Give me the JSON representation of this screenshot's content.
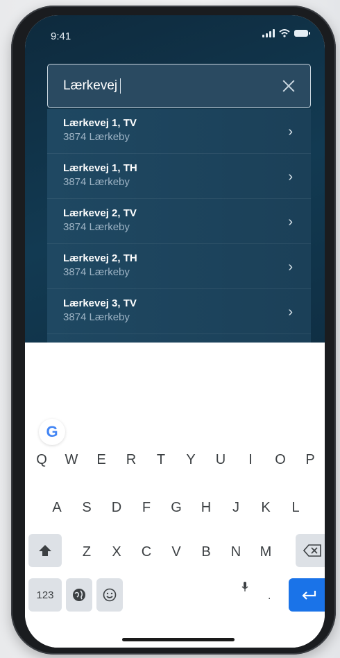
{
  "status": {
    "time": "9:41"
  },
  "search": {
    "value": "Lærkevej"
  },
  "results": [
    {
      "title": "Lærkevej 1, TV",
      "subtitle": "3874 Lærkeby"
    },
    {
      "title": "Lærkevej 1, TH",
      "subtitle": "3874 Lærkeby"
    },
    {
      "title": "Lærkevej 2, TV",
      "subtitle": "3874 Lærkeby"
    },
    {
      "title": "Lærkevej 2, TH",
      "subtitle": "3874 Lærkeby"
    },
    {
      "title": "Lærkevej 3, TV",
      "subtitle": "3874 Lærkeby"
    }
  ],
  "keyboard": {
    "brand": "G",
    "row1": [
      "Q",
      "W",
      "E",
      "R",
      "T",
      "Y",
      "U",
      "I",
      "O",
      "P"
    ],
    "row2": [
      "A",
      "S",
      "D",
      "F",
      "G",
      "H",
      "J",
      "K",
      "L"
    ],
    "row3": [
      "Z",
      "X",
      "C",
      "V",
      "B",
      "N",
      "M"
    ],
    "numbers_label": "123",
    "period_label": ".",
    "accent": "#1a73e8"
  },
  "icons": {
    "clear": "close-icon",
    "chevron": "chevron-right-icon",
    "shift": "shift-icon",
    "backspace": "backspace-icon",
    "globe": "globe-icon",
    "emoji": "emoji-icon",
    "mic": "microphone-icon",
    "enter": "enter-icon"
  }
}
